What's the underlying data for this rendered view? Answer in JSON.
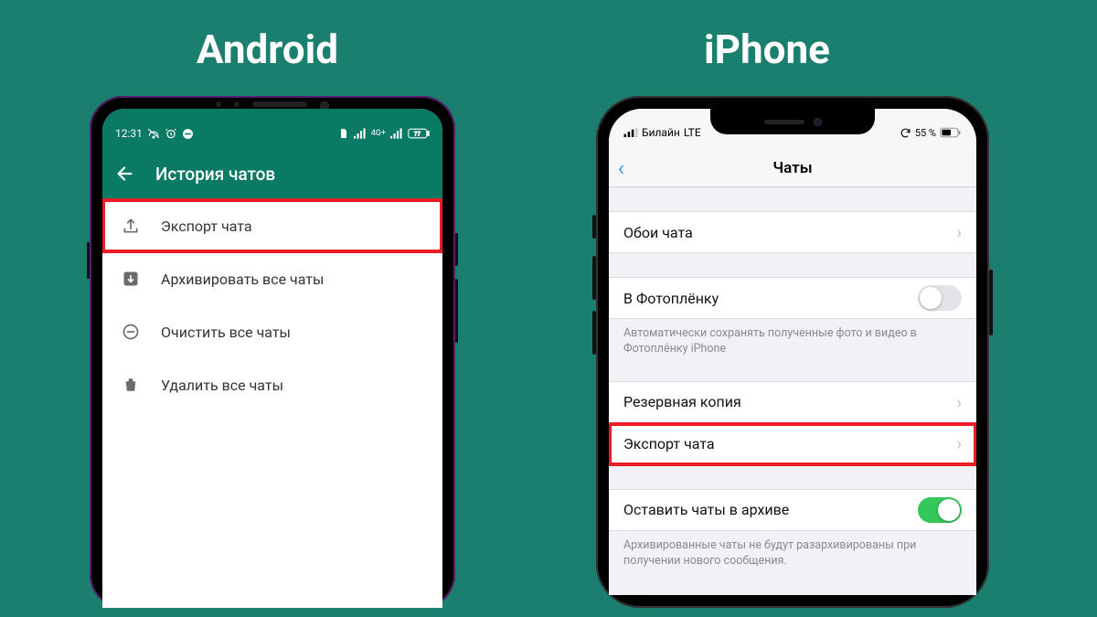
{
  "headings": {
    "android": "Android",
    "iphone": "iPhone"
  },
  "android": {
    "status": {
      "time": "12:31",
      "battery": "77"
    },
    "header": {
      "title": "История чатов"
    },
    "rows": [
      {
        "label": "Экспорт чата",
        "icon": "upload-icon",
        "highlight": true
      },
      {
        "label": "Архивировать все чаты",
        "icon": "archive-icon"
      },
      {
        "label": "Очистить все чаты",
        "icon": "minus-circle-icon"
      },
      {
        "label": "Удалить все чаты",
        "icon": "trash-icon"
      }
    ]
  },
  "iphone": {
    "status": {
      "carrier": "Билайн",
      "network": "LTE",
      "battery": "55 %"
    },
    "nav": {
      "title": "Чаты"
    },
    "section1": [
      {
        "label": "Обои чата",
        "chevron": true
      }
    ],
    "section2": {
      "row": {
        "label": "В Фотоплёнку",
        "toggle": "off"
      },
      "desc": "Автоматически сохранять полученные фото и видео в Фотоплёнку iPhone"
    },
    "section3": [
      {
        "label": "Резервная копия",
        "chevron": true
      },
      {
        "label": "Экспорт чата",
        "chevron": true,
        "highlight": true
      }
    ],
    "section4": {
      "row": {
        "label": "Оставить чаты в архиве",
        "toggle": "on"
      },
      "desc": "Архивированные чаты не будут разархивированы при получении нового сообщения."
    }
  }
}
